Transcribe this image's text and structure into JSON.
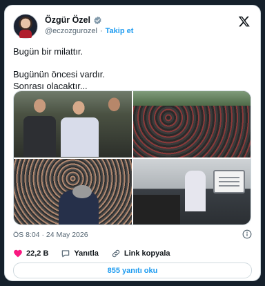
{
  "tweet": {
    "author": {
      "name": "Özgür Özel",
      "handle": "@eczozgurozel",
      "follow_label": "Takip et"
    },
    "text_lines": [
      "Bugün bir milattır.",
      "Bugünün öncesi vardır.",
      "Sonrası olacaktır..."
    ],
    "timestamp": "ÖS 8:04 · 24 May 2026",
    "actions": {
      "likes_count": "22,2 B",
      "reply_label": "Yanıtla",
      "copy_link_label": "Link kopyala"
    },
    "read_replies_label": "855 yanıtı oku",
    "accent_color": "#1d9bf0",
    "like_color": "#f91880"
  }
}
